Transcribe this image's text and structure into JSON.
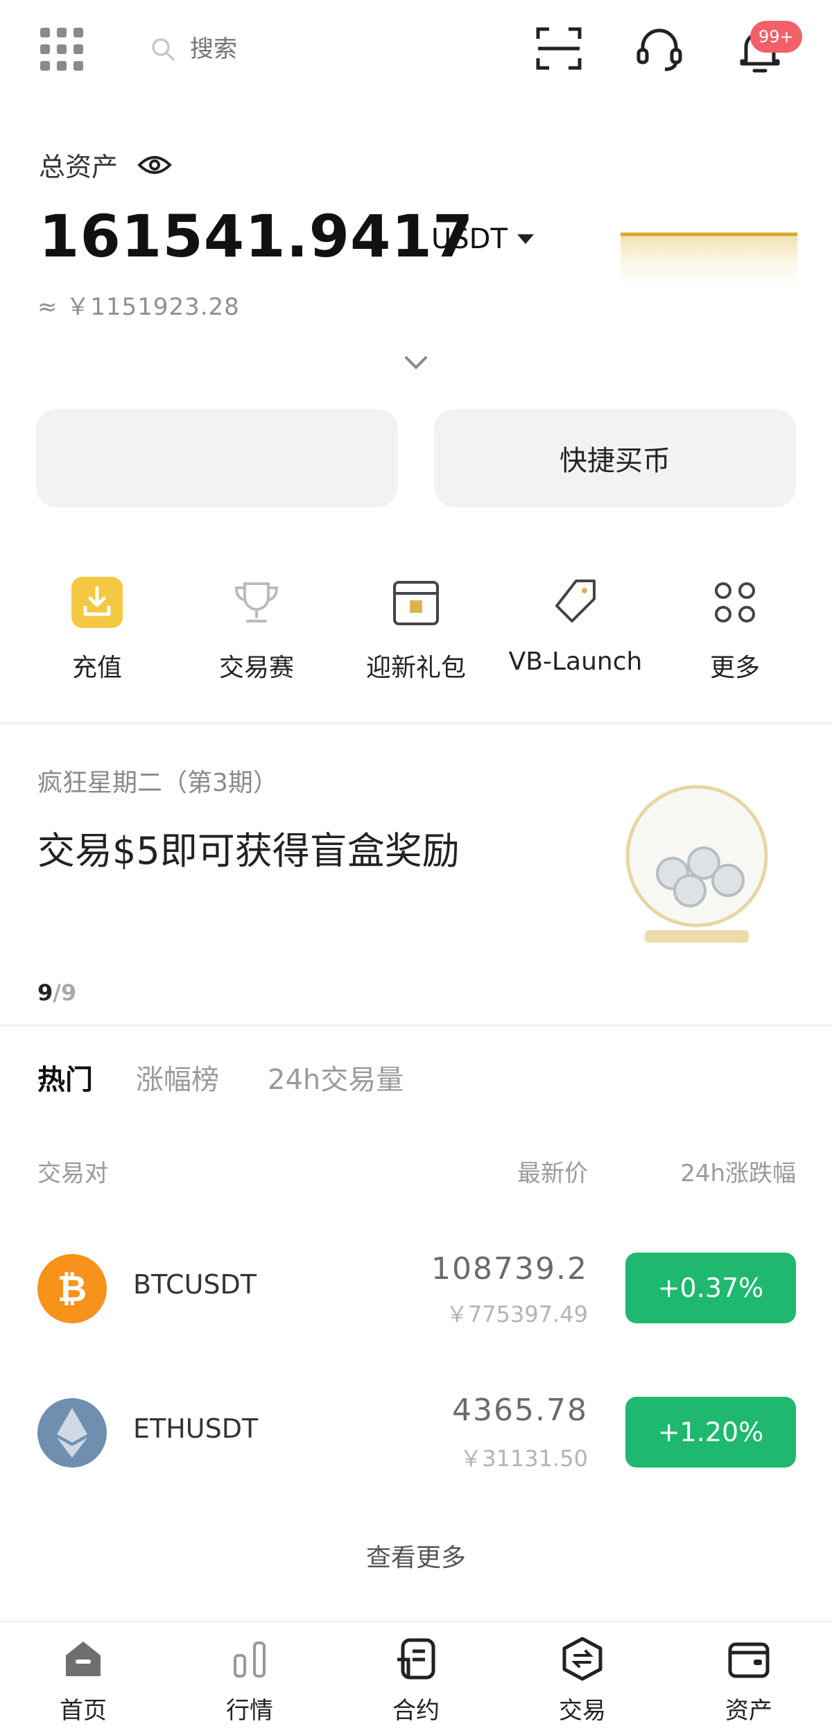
{
  "header": {
    "search_placeholder": "搜索",
    "notification_badge": "99+"
  },
  "assets": {
    "label": "总资产",
    "value": "161541.9417",
    "unit": "USDT",
    "cny_value": "≈ ￥1151923.28"
  },
  "actions": {
    "left_label": "",
    "right_label": "快捷买币"
  },
  "shortcuts": [
    {
      "label": "充值",
      "icon": "deposit-icon"
    },
    {
      "label": "交易赛",
      "icon": "trophy-icon"
    },
    {
      "label": "迎新礼包",
      "icon": "gift-icon"
    },
    {
      "label": "VB-Launch",
      "icon": "launch-icon"
    },
    {
      "label": "更多",
      "icon": "more-grid-icon"
    }
  ],
  "banner": {
    "subtitle": "疯狂星期二（第3期）",
    "title": "交易$5即可获得盲盒奖励",
    "page_current": "9",
    "page_sep_total": "/9"
  },
  "market": {
    "tabs": [
      "热门",
      "涨幅榜",
      "24h交易量"
    ],
    "active_tab": 0,
    "columns": {
      "pair": "交易对",
      "price": "最新价",
      "change": "24h涨跌幅"
    },
    "rows": [
      {
        "pair": "BTCUSDT",
        "price": "108739.2",
        "price_cny": "￥775397.49",
        "change": "+0.37%",
        "icon": "bitcoin-icon",
        "color": "#1fb86f"
      },
      {
        "pair": "ETHUSDT",
        "price": "4365.78",
        "price_cny": "￥31131.50",
        "change": "+1.20%",
        "icon": "ethereum-icon",
        "color": "#1fb86f"
      }
    ],
    "view_more": "查看更多"
  },
  "nav": [
    {
      "label": "首页",
      "icon": "home-icon"
    },
    {
      "label": "行情",
      "icon": "market-icon"
    },
    {
      "label": "合约",
      "icon": "contract-icon"
    },
    {
      "label": "交易",
      "icon": "trade-icon"
    },
    {
      "label": "资产",
      "icon": "wallet-icon"
    }
  ],
  "colors": {
    "accent_green": "#1fb86f",
    "badge_red": "#f3606a",
    "deposit_yellow": "#f5c842"
  }
}
